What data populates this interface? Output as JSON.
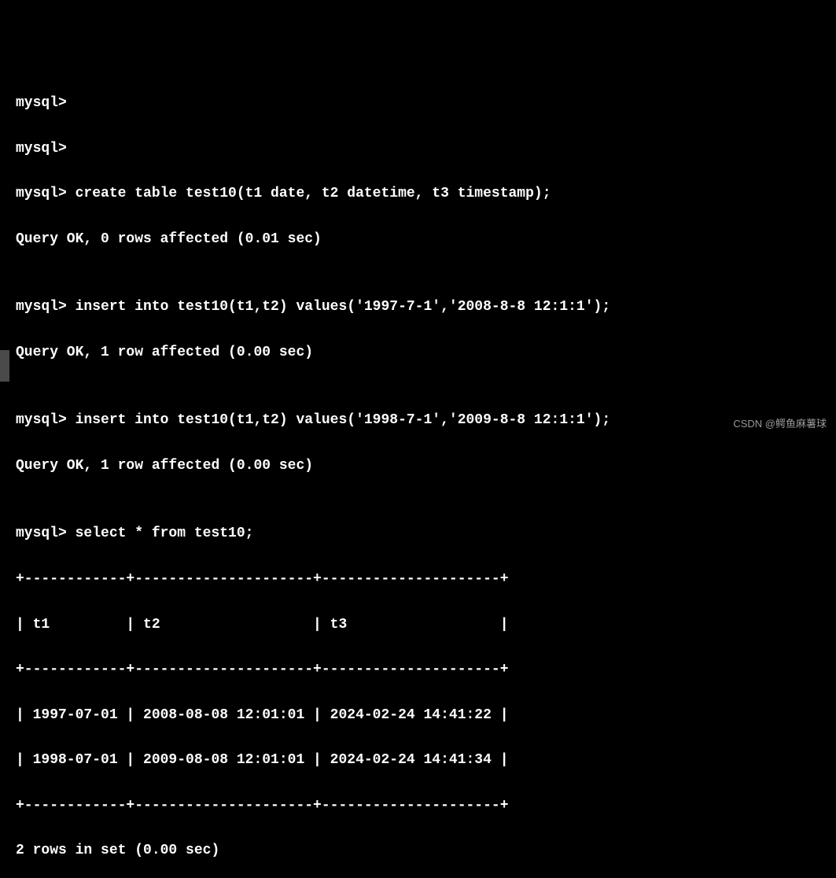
{
  "lines": {
    "l0": "mysql>",
    "l1": "mysql>",
    "l2": "mysql> create table test10(t1 date, t2 datetime, t3 timestamp);",
    "l3": "Query OK, 0 rows affected (0.01 sec)",
    "l4": "",
    "l5": "mysql> insert into test10(t1,t2) values('1997-7-1','2008-8-8 12:1:1');",
    "l6": "Query OK, 1 row affected (0.00 sec)",
    "l7": "",
    "l8": "mysql> insert into test10(t1,t2) values('1998-7-1','2009-8-8 12:1:1');",
    "l9": "Query OK, 1 row affected (0.00 sec)",
    "l10": "",
    "l11": "mysql> select * from test10;",
    "l12": "+------------+---------------------+---------------------+",
    "l13": "| t1         | t2                  | t3                  |",
    "l14": "+------------+---------------------+---------------------+",
    "l15": "| 1997-07-01 | 2008-08-08 12:01:01 | 2024-02-24 14:41:22 |",
    "l16": "| 1998-07-01 | 2009-08-08 12:01:01 | 2024-02-24 14:41:34 |",
    "l17": "+------------+---------------------+---------------------+",
    "l18": "2 rows in set (0.00 sec)"
  },
  "watermark": "CSDN @鳄鱼麻薯球",
  "chart_data": {
    "type": "table",
    "columns": [
      "t1",
      "t2",
      "t3"
    ],
    "rows": [
      [
        "1997-07-01",
        "2008-08-08 12:01:01",
        "2024-02-24 14:41:22"
      ],
      [
        "1998-07-01",
        "2009-08-08 12:01:01",
        "2024-02-24 14:41:34"
      ]
    ],
    "summary": "2 rows in set (0.00 sec)"
  }
}
